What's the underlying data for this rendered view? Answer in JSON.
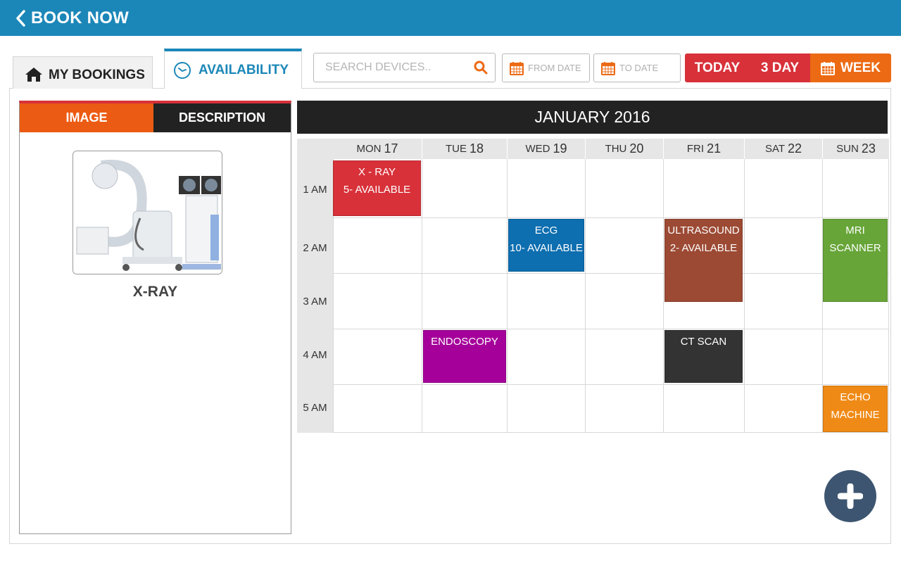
{
  "header": {
    "title": "BOOK NOW",
    "accent": "#1b87b8"
  },
  "tabs": {
    "bookings": "MY BOOKINGS",
    "availability": "AVAILABILITY"
  },
  "search": {
    "placeholder": "SEARCH DEVICES.."
  },
  "dates": {
    "from": "FROM DATE",
    "to": "TO DATE"
  },
  "view": {
    "today": "TODAY",
    "three_day": "3 DAY",
    "week": "WEEK",
    "selected": "WEEK"
  },
  "panel": {
    "image_tab": "IMAGE",
    "description_tab": "DESCRIPTION",
    "device_name": "X-RAY"
  },
  "calendar": {
    "month": "JANUARY 2016",
    "days": [
      {
        "dow": "MON",
        "num": "17"
      },
      {
        "dow": "TUE",
        "num": "18"
      },
      {
        "dow": "WED",
        "num": "19"
      },
      {
        "dow": "THU",
        "num": "20"
      },
      {
        "dow": "FRI",
        "num": "21"
      },
      {
        "dow": "SAT",
        "num": "22"
      },
      {
        "dow": "SUN",
        "num": "23"
      }
    ],
    "times": [
      "1 AM",
      "2 AM",
      "3 AM",
      "4 AM",
      "5 AM"
    ],
    "events": [
      {
        "line1": "X - RAY",
        "line2": "5- AVAILABLE",
        "color": "#d8313a"
      },
      {
        "line1": "ECG",
        "line2": "10- AVAILABLE",
        "color": "#0d6eb0"
      },
      {
        "line1": "ULTRASOUND",
        "line2": "2- AVAILABLE",
        "color": "#9c4a34"
      },
      {
        "line1": "MRI",
        "line2": "SCANNER",
        "color": "#67a538"
      },
      {
        "line1": "ENDOSCOPY",
        "line2": "",
        "color": "#a5009a"
      },
      {
        "line1": "CT SCAN",
        "line2": "",
        "color": "#333333"
      },
      {
        "line1": "ECHO",
        "line2": "MACHINE",
        "color": "#f08a16"
      }
    ]
  }
}
